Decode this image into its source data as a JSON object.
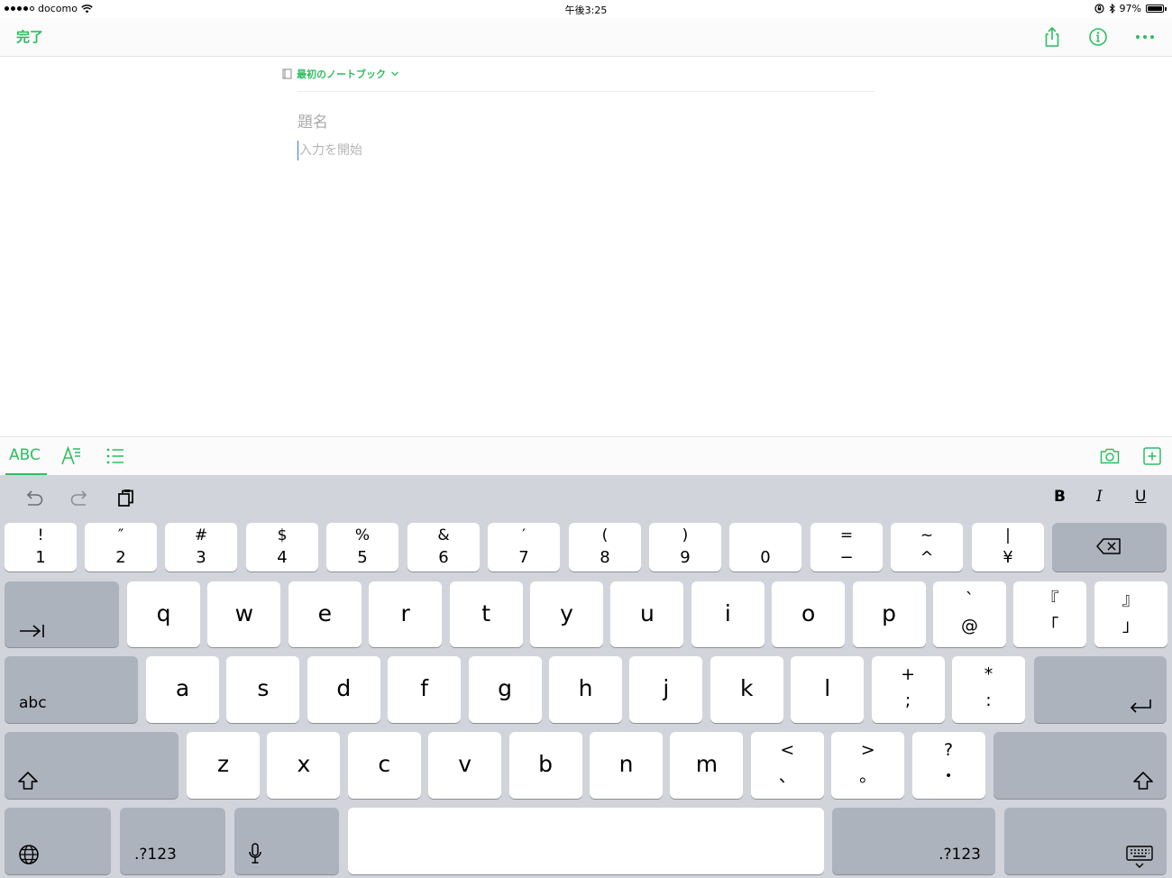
{
  "status_bar": {
    "carrier": "docomo",
    "time": "午後3:25",
    "battery": "97%",
    "battery_level": 0.97
  },
  "nav": {
    "done_label": "完了",
    "icons": [
      "share-icon",
      "info-icon",
      "more-icon"
    ]
  },
  "note": {
    "notebook_name": "最初のノートブック",
    "title_placeholder": "題名",
    "body_placeholder": "入力を開始"
  },
  "format_bar": {
    "abc_label": "ABC",
    "icons": [
      "text-format-icon",
      "list-icon",
      "camera-icon",
      "add-attachment-icon"
    ]
  },
  "keyboard": {
    "shortcuts": {
      "bold": "B",
      "italic": "I",
      "underline": "U"
    },
    "number_row": [
      {
        "sym": "!",
        "num": "1"
      },
      {
        "sym": "″",
        "num": "2"
      },
      {
        "sym": "#",
        "num": "3"
      },
      {
        "sym": "$",
        "num": "4"
      },
      {
        "sym": "%",
        "num": "5"
      },
      {
        "sym": "&",
        "num": "6"
      },
      {
        "sym": "′",
        "num": "7"
      },
      {
        "sym": "(",
        "num": "8"
      },
      {
        "sym": ")",
        "num": "9"
      },
      {
        "sym": "",
        "num": "0"
      },
      {
        "sym": "=",
        "num": "−"
      },
      {
        "sym": "~",
        "num": "^"
      },
      {
        "sym": "|",
        "num": "¥"
      }
    ],
    "row_q": [
      "q",
      "w",
      "e",
      "r",
      "t",
      "y",
      "u",
      "i",
      "o",
      "p"
    ],
    "row_q_extra": [
      {
        "top": "`",
        "bot": "@"
      },
      {
        "top": "『",
        "bot": "「"
      },
      {
        "top": "』",
        "bot": "」"
      }
    ],
    "row_a": [
      "a",
      "s",
      "d",
      "f",
      "g",
      "h",
      "j",
      "k",
      "l"
    ],
    "row_a_extra": [
      {
        "top": "+",
        "bot": ";"
      },
      {
        "top": "*",
        "bot": ":"
      }
    ],
    "row_z": [
      "z",
      "x",
      "c",
      "v",
      "b",
      "n",
      "m"
    ],
    "row_z_extra": [
      {
        "top": "<",
        "bot": "、"
      },
      {
        "top": ">",
        "bot": "。"
      },
      {
        "top": "?",
        "bot": "・"
      }
    ],
    "abc_key": "abc",
    "numbers_key": ".?123"
  }
}
